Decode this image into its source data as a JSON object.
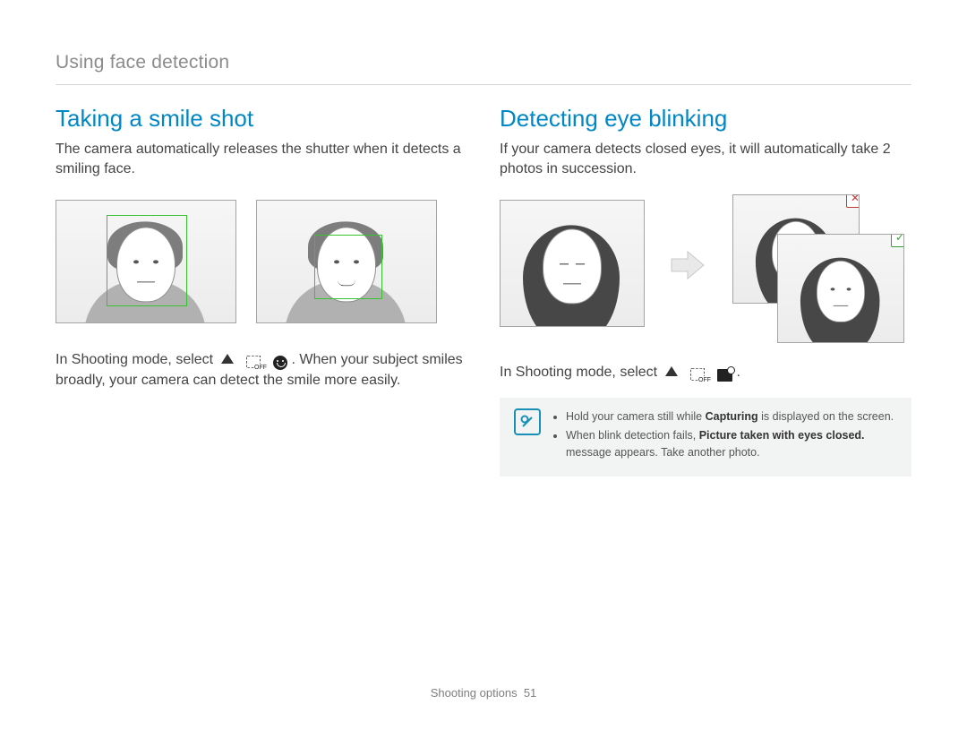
{
  "breadcrumb": "Using face detection",
  "left": {
    "heading": "Taking a smile shot",
    "intro": "The camera automatically releases the shutter when it detects a smiling face.",
    "instruction_prefix": "In Shooting mode, select",
    "instruction_suffix": ". When your subject smiles broadly, your camera can detect the smile more easily.",
    "off_label": "OFF"
  },
  "right": {
    "heading": "Detecting eye blinking",
    "intro": "If your camera detects closed eyes, it will automatically take 2 photos in succession.",
    "instruction_prefix": "In Shooting mode, select",
    "instruction_period": ".",
    "off_label": "OFF",
    "notes": [
      {
        "pre": "Hold your camera still while ",
        "bold": "Capturing",
        "post": " is displayed on the screen."
      },
      {
        "pre": "When blink detection fails, ",
        "bold": "Picture taken with eyes closed.",
        "post": " message appears. Take another photo."
      }
    ]
  },
  "footer": {
    "section": "Shooting options",
    "page": "51"
  }
}
